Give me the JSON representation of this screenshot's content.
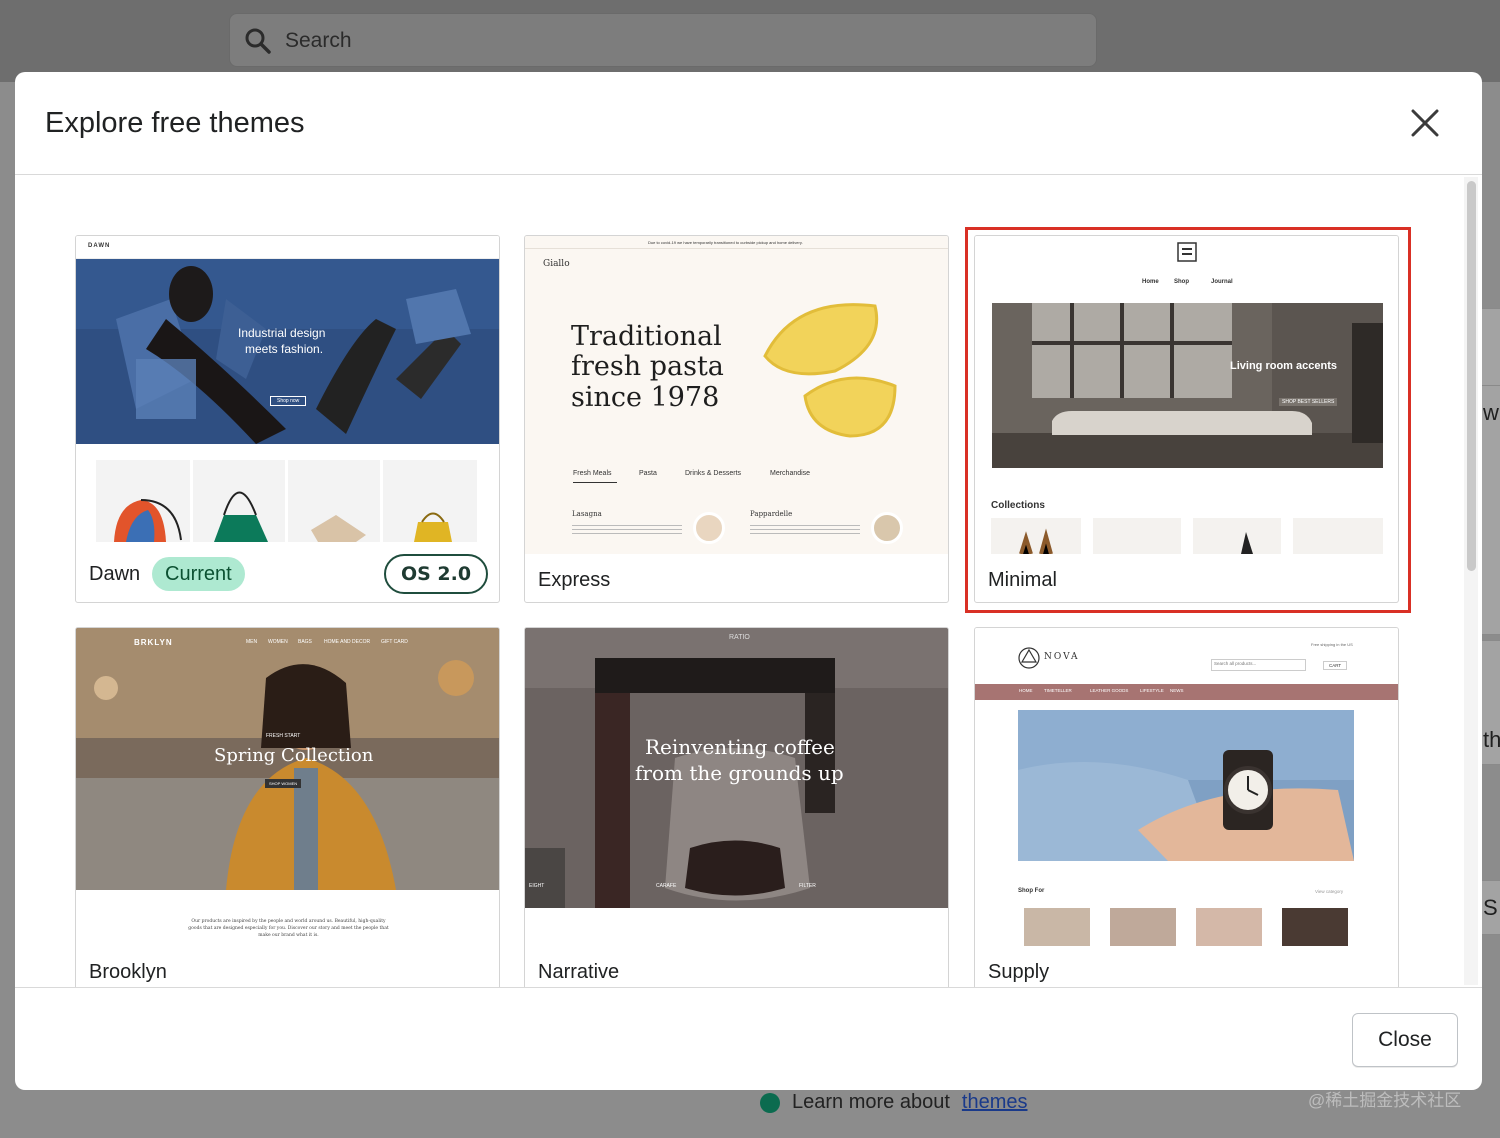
{
  "background": {
    "search_placeholder": "Search",
    "side_fragments": [
      "w",
      "the",
      "S"
    ],
    "learn_more": "Learn more about",
    "learn_more_link": "themes",
    "watermark": "@稀土掘金技术社区"
  },
  "modal": {
    "title": "Explore free themes",
    "close_button": "Close",
    "themes": [
      {
        "name": "Dawn",
        "current_badge": "Current",
        "os_badge": "OS 2.0",
        "preview": {
          "logo": "DAWN",
          "hero_line1": "Industrial design",
          "hero_line2": "meets fashion.",
          "hero_button": "Shop now"
        }
      },
      {
        "name": "Express",
        "preview": {
          "announcement": "Due to covid-19 we have temporarily transitioned to curbside pickup and home delivery.",
          "logo": "Giallo",
          "hero_line1": "Traditional",
          "hero_line2": "fresh pasta",
          "hero_line3": "since 1978",
          "tabs": [
            "Fresh Meals",
            "Pasta",
            "Drinks & Desserts",
            "Merchandise"
          ],
          "item1": "Lasagna",
          "item2": "Pappardelle"
        }
      },
      {
        "name": "Minimal",
        "selected": true,
        "preview": {
          "nav": [
            "Home",
            "Shop",
            "Journal"
          ],
          "hero_title": "Living room accents",
          "hero_button": "SHOP BEST SELLERS",
          "collections": "Collections"
        }
      },
      {
        "name": "Brooklyn",
        "preview": {
          "logo": "BRKLYN",
          "nav": [
            "MEN",
            "WOMEN",
            "BAGS",
            "HOME AND DECOR",
            "GIFT CARD"
          ],
          "kicker": "FRESH START",
          "hero_title": "Spring Collection",
          "hero_button": "SHOP WOMEN",
          "body_text": "Our products are inspired by the people and world around us. Beautiful, high-quality goods that are designed especially for you. Discover our story and meet the people that make our brand what it is."
        }
      },
      {
        "name": "Narrative",
        "preview": {
          "logo": "RATIO",
          "hero_line1": "Reinventing coffee",
          "hero_line2": "from the grounds up",
          "labels": [
            "EIGHT",
            "CARAFE",
            "FILTER"
          ]
        }
      },
      {
        "name": "Supply",
        "preview": {
          "logo": "NOVA",
          "shipping": "Free shipping in the US",
          "search": "Search all products...",
          "cart": "CART",
          "nav": [
            "HOME",
            "TIMETELLER",
            "LEATHER GOODS",
            "LIFESTYLE",
            "NEWS"
          ],
          "shop_for": "Shop For",
          "view_all": "View category"
        }
      }
    ]
  },
  "colors": {
    "overlay": "#8c8c8c",
    "highlight": "#d93025",
    "current_badge_bg": "#aee9d1",
    "os_badge_border": "#1f4d3d"
  }
}
